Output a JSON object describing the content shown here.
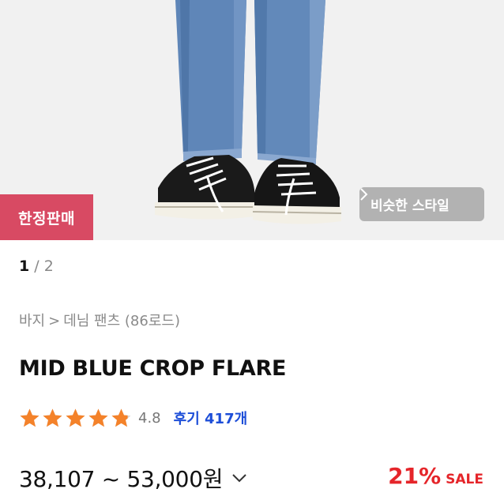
{
  "hero": {
    "badge": "한정판매",
    "similar_button": "비슷한 스타일",
    "accent_badge": "#d84a63"
  },
  "pager": {
    "current": "1",
    "separator": " / ",
    "total": "2"
  },
  "breadcrumb": {
    "level1": "바지",
    "separator": ">",
    "level2": "데님 팬츠 (86로드)"
  },
  "product": {
    "title": "MID BLUE CROP FLARE",
    "rating": "4.8",
    "stars": 4.8,
    "reviews_label": "후기 417개",
    "price": "38,107 ~ 53,000원",
    "discount_pct": "21%",
    "sale_label": "SALE",
    "colors": {
      "star": "#f4822a",
      "discount": "#e5252a",
      "review_link": "#1d4ed8"
    }
  }
}
